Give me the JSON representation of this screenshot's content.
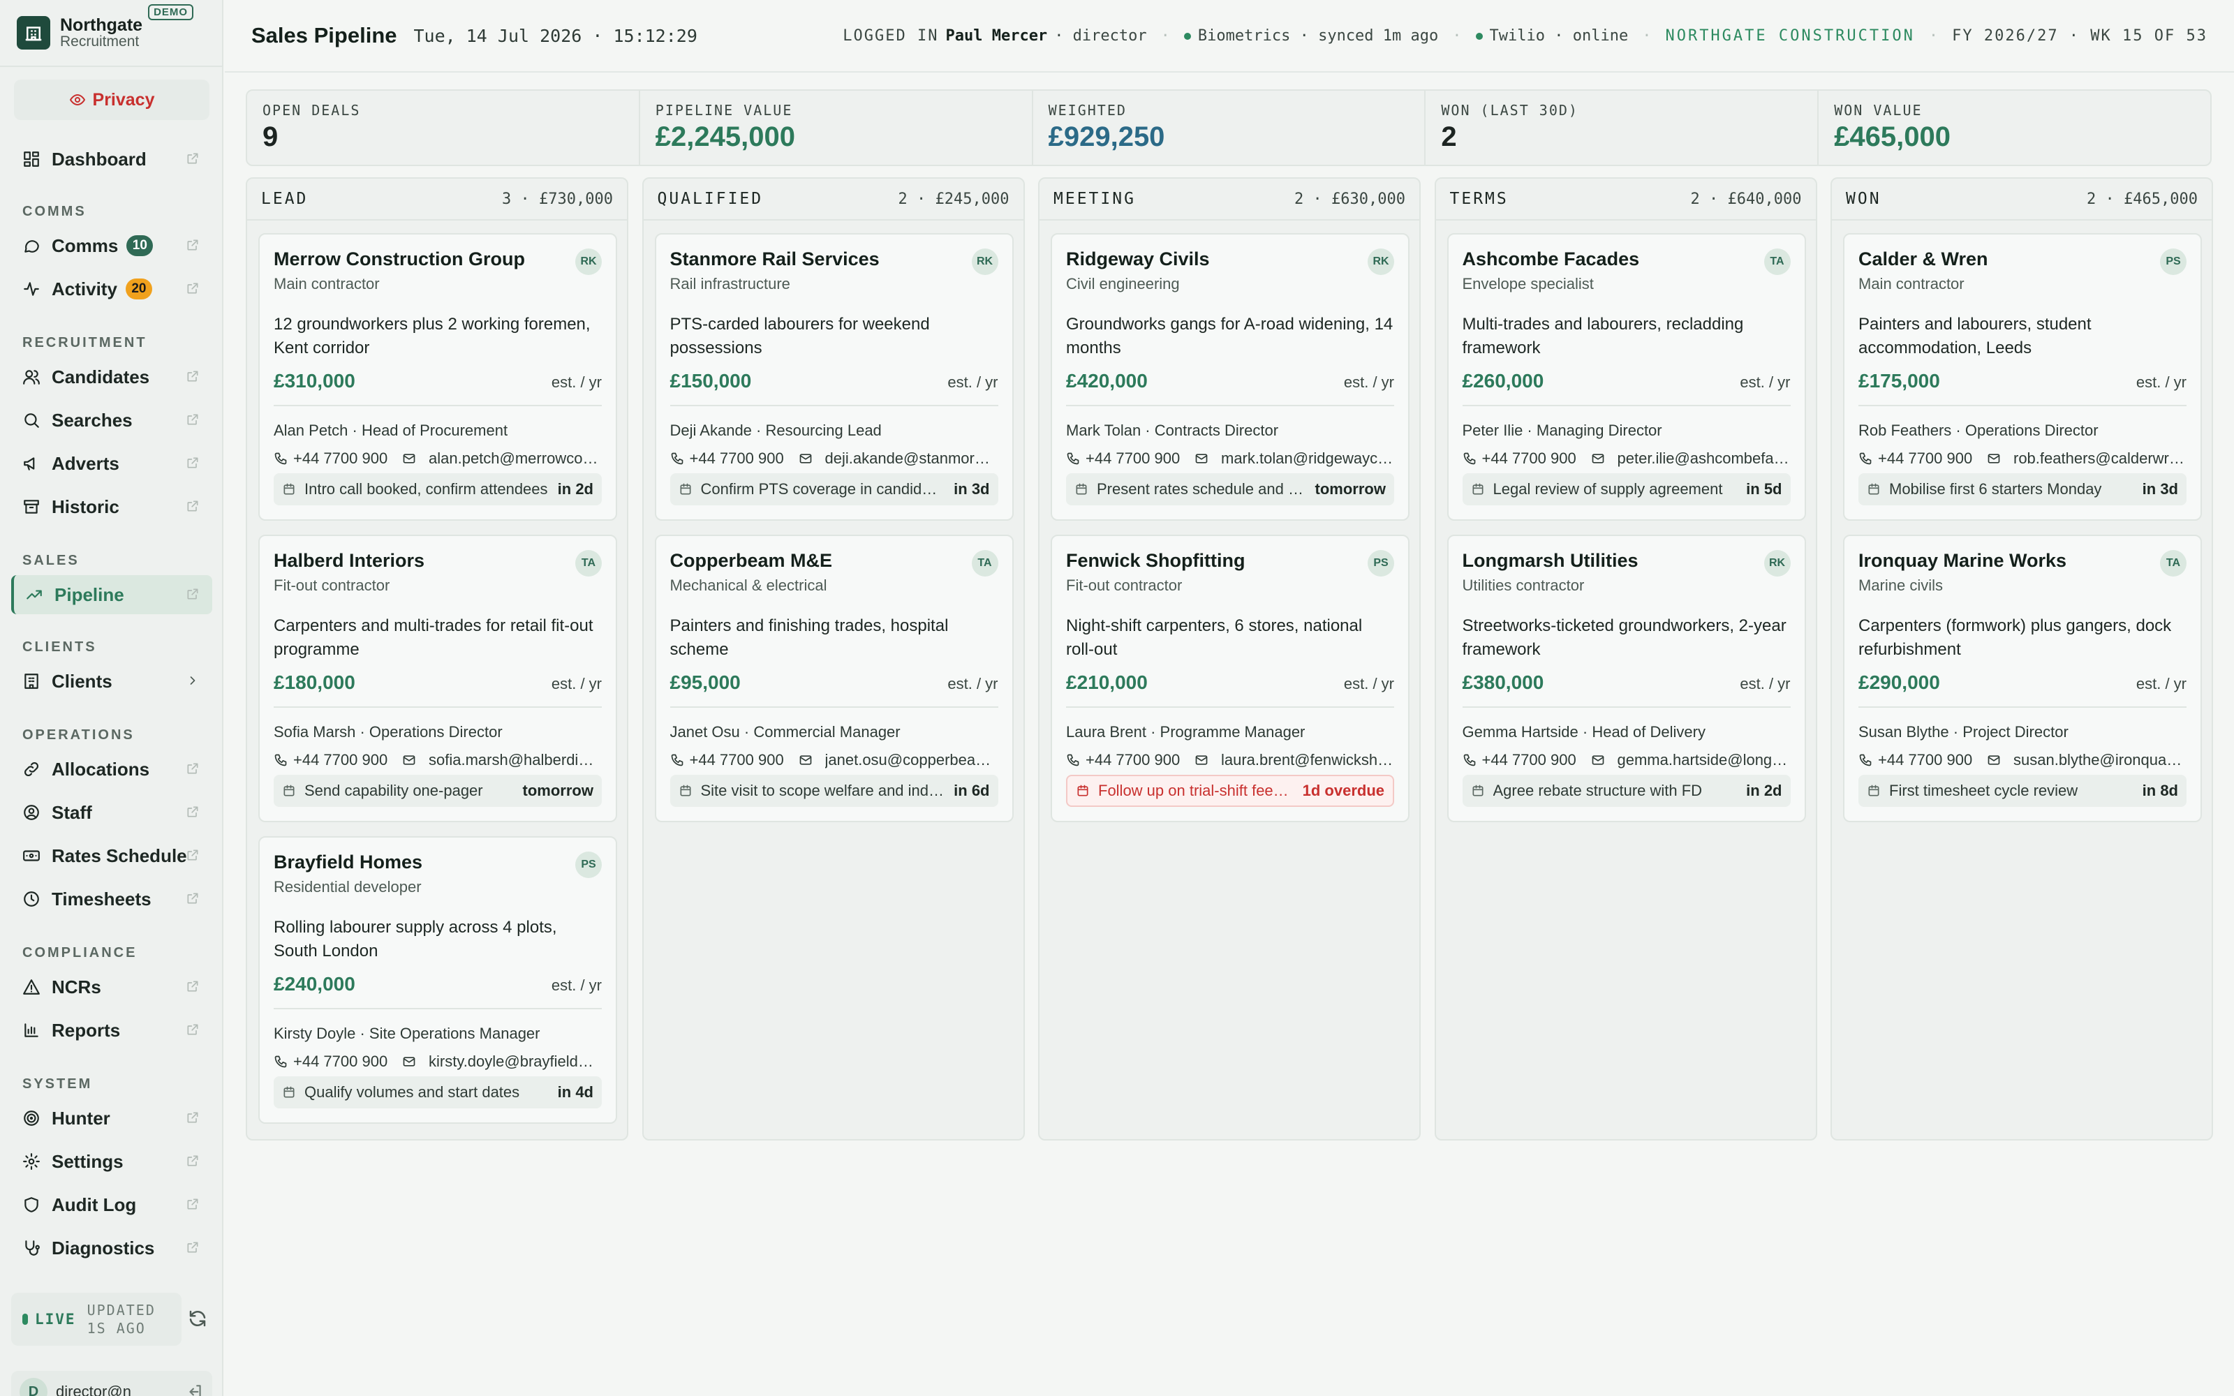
{
  "brand": {
    "name": "Northgate",
    "sub": "Recruitment",
    "badge": "DEMO"
  },
  "privacy_label": "Privacy",
  "nav": {
    "dashboard": "Dashboard",
    "sec_comms": "COMMS",
    "comms": "Comms",
    "comms_count": "10",
    "activity": "Activity",
    "activity_count": "20",
    "sec_recruitment": "RECRUITMENT",
    "candidates": "Candidates",
    "searches": "Searches",
    "adverts": "Adverts",
    "historic": "Historic",
    "sec_sales": "SALES",
    "pipeline": "Pipeline",
    "sec_clients": "CLIENTS",
    "clients": "Clients",
    "sec_operations": "OPERATIONS",
    "allocations": "Allocations",
    "staff": "Staff",
    "rates": "Rates Schedule",
    "timesheets": "Timesheets",
    "sec_compliance": "COMPLIANCE",
    "ncrs": "NCRs",
    "reports": "Reports",
    "sec_system": "SYSTEM",
    "hunter": "Hunter",
    "settings": "Settings",
    "audit": "Audit Log",
    "diagnostics": "Diagnostics"
  },
  "live": {
    "label": "LIVE",
    "updated_1": "UPDATED",
    "updated_2": "1S AGO"
  },
  "user": {
    "initial": "D",
    "email": "director@n"
  },
  "header": {
    "title": "Sales Pipeline",
    "datetime": "Tue, 14 Jul 2026 · 15:12:29",
    "logged_in": "LOGGED IN",
    "user_name": "Paul Mercer",
    "user_role": "· director",
    "biometrics": "Biometrics · synced 1m ago",
    "twilio": "Twilio · online",
    "company": "NORTHGATE CONSTRUCTION",
    "fy": "FY 2026/27 · WK 15 OF 53"
  },
  "stats": [
    {
      "label": "OPEN DEALS",
      "value": "9"
    },
    {
      "label": "PIPELINE VALUE",
      "value": "£2,245,000"
    },
    {
      "label": "WEIGHTED",
      "value": "£929,250"
    },
    {
      "label": "WON (LAST 30D)",
      "value": "2"
    },
    {
      "label": "WON VALUE",
      "value": "£465,000"
    }
  ],
  "columns": [
    {
      "name": "LEAD",
      "meta": "3 · £730,000",
      "cards": [
        {
          "title": "Merrow Construction Group",
          "owner": "RK",
          "sub": "Main contractor",
          "desc": "12 groundworkers plus 2 working foremen, Kent corridor",
          "value": "£310,000",
          "est": "est. / yr",
          "contact": "Alan Petch · Head of Procurement",
          "phone": "+44 7700 900",
          "email": "alan.petch@merrowconstruction.co.uk",
          "task": "Intro call booked, confirm attendees",
          "due": "in 2d",
          "overdue": false
        },
        {
          "title": "Halberd Interiors",
          "owner": "TA",
          "sub": "Fit-out contractor",
          "desc": "Carpenters and multi-trades for retail fit-out programme",
          "value": "£180,000",
          "est": "est. / yr",
          "contact": "Sofia Marsh · Operations Director",
          "phone": "+44 7700 900",
          "email": "sofia.marsh@halberdinteriors.co.uk",
          "task": "Send capability one-pager",
          "due": "tomorrow",
          "overdue": false
        },
        {
          "title": "Brayfield Homes",
          "owner": "PS",
          "sub": "Residential developer",
          "desc": "Rolling labourer supply across 4 plots, South London",
          "value": "£240,000",
          "est": "est. / yr",
          "contact": "Kirsty Doyle · Site Operations Manager",
          "phone": "+44 7700 900",
          "email": "kirsty.doyle@brayfieldhomes.co.uk",
          "task": "Qualify volumes and start dates",
          "due": "in 4d",
          "overdue": false
        }
      ]
    },
    {
      "name": "QUALIFIED",
      "meta": "2 · £245,000",
      "cards": [
        {
          "title": "Stanmore Rail Services",
          "owner": "RK",
          "sub": "Rail infrastructure",
          "desc": "PTS-carded labourers for weekend possessions",
          "value": "£150,000",
          "est": "est. / yr",
          "contact": "Deji Akande · Resourcing Lead",
          "phone": "+44 7700 900",
          "email": "deji.akande@stanmorerail.co.uk",
          "task": "Confirm PTS coverage in candidate pool",
          "due": "in 3d",
          "overdue": false
        },
        {
          "title": "Copperbeam M&E",
          "owner": "TA",
          "sub": "Mechanical & electrical",
          "desc": "Painters and finishing trades, hospital scheme",
          "value": "£95,000",
          "est": "est. / yr",
          "contact": "Janet Osu · Commercial Manager",
          "phone": "+44 7700 900",
          "email": "janet.osu@copperbeam.co.uk",
          "task": "Site visit to scope welfare and induction",
          "due": "in 6d",
          "overdue": false
        }
      ]
    },
    {
      "name": "MEETING",
      "meta": "2 · £630,000",
      "cards": [
        {
          "title": "Ridgeway Civils",
          "owner": "RK",
          "sub": "Civil engineering",
          "desc": "Groundworks gangs for A-road widening, 14 months",
          "value": "£420,000",
          "est": "est. / yr",
          "contact": "Mark Tolan · Contracts Director",
          "phone": "+44 7700 900",
          "email": "mark.tolan@ridgewaycivils.co.uk",
          "task": "Present rates schedule and terms",
          "due": "tomorrow",
          "overdue": false
        },
        {
          "title": "Fenwick Shopfitting",
          "owner": "PS",
          "sub": "Fit-out contractor",
          "desc": "Night-shift carpenters, 6 stores, national roll-out",
          "value": "£210,000",
          "est": "est. / yr",
          "contact": "Laura Brent · Programme Manager",
          "phone": "+44 7700 900",
          "email": "laura.brent@fenwickshopfitting.co.uk",
          "task": "Follow up on trial-shift feedback",
          "due": "1d overdue",
          "overdue": true
        }
      ]
    },
    {
      "name": "TERMS",
      "meta": "2 · £640,000",
      "cards": [
        {
          "title": "Ashcombe Facades",
          "owner": "TA",
          "sub": "Envelope specialist",
          "desc": "Multi-trades and labourers, recladding framework",
          "value": "£260,000",
          "est": "est. / yr",
          "contact": "Peter Ilie · Managing Director",
          "phone": "+44 7700 900",
          "email": "peter.ilie@ashcombefacades.co.uk",
          "task": "Legal review of supply agreement",
          "due": "in 5d",
          "overdue": false
        },
        {
          "title": "Longmarsh Utilities",
          "owner": "RK",
          "sub": "Utilities contractor",
          "desc": "Streetworks-ticketed groundworkers, 2-year framework",
          "value": "£380,000",
          "est": "est. / yr",
          "contact": "Gemma Hartside · Head of Delivery",
          "phone": "+44 7700 900",
          "email": "gemma.hartside@longmarsh.co.uk",
          "task": "Agree rebate structure with FD",
          "due": "in 2d",
          "overdue": false
        }
      ]
    },
    {
      "name": "WON",
      "meta": "2 · £465,000",
      "cards": [
        {
          "title": "Calder & Wren",
          "owner": "PS",
          "sub": "Main contractor",
          "desc": "Painters and labourers, student accommodation, Leeds",
          "value": "£175,000",
          "est": "est. / yr",
          "contact": "Rob Feathers · Operations Director",
          "phone": "+44 7700 900",
          "email": "rob.feathers@calderwren.co.uk",
          "task": "Mobilise first 6 starters Monday",
          "due": "in 3d",
          "overdue": false
        },
        {
          "title": "Ironquay Marine Works",
          "owner": "TA",
          "sub": "Marine civils",
          "desc": "Carpenters (formwork) plus gangers, dock refurbishment",
          "value": "£290,000",
          "est": "est. / yr",
          "contact": "Susan Blythe · Project Director",
          "phone": "+44 7700 900",
          "email": "susan.blythe@ironquaymarine.co.uk",
          "task": "First timesheet cycle review",
          "due": "in 8d",
          "overdue": false
        }
      ]
    }
  ],
  "colors": {
    "accent": "#2d7a5b",
    "brand": "#1f4a3c",
    "danger": "#c8302e",
    "amber": "#f0a11d"
  }
}
